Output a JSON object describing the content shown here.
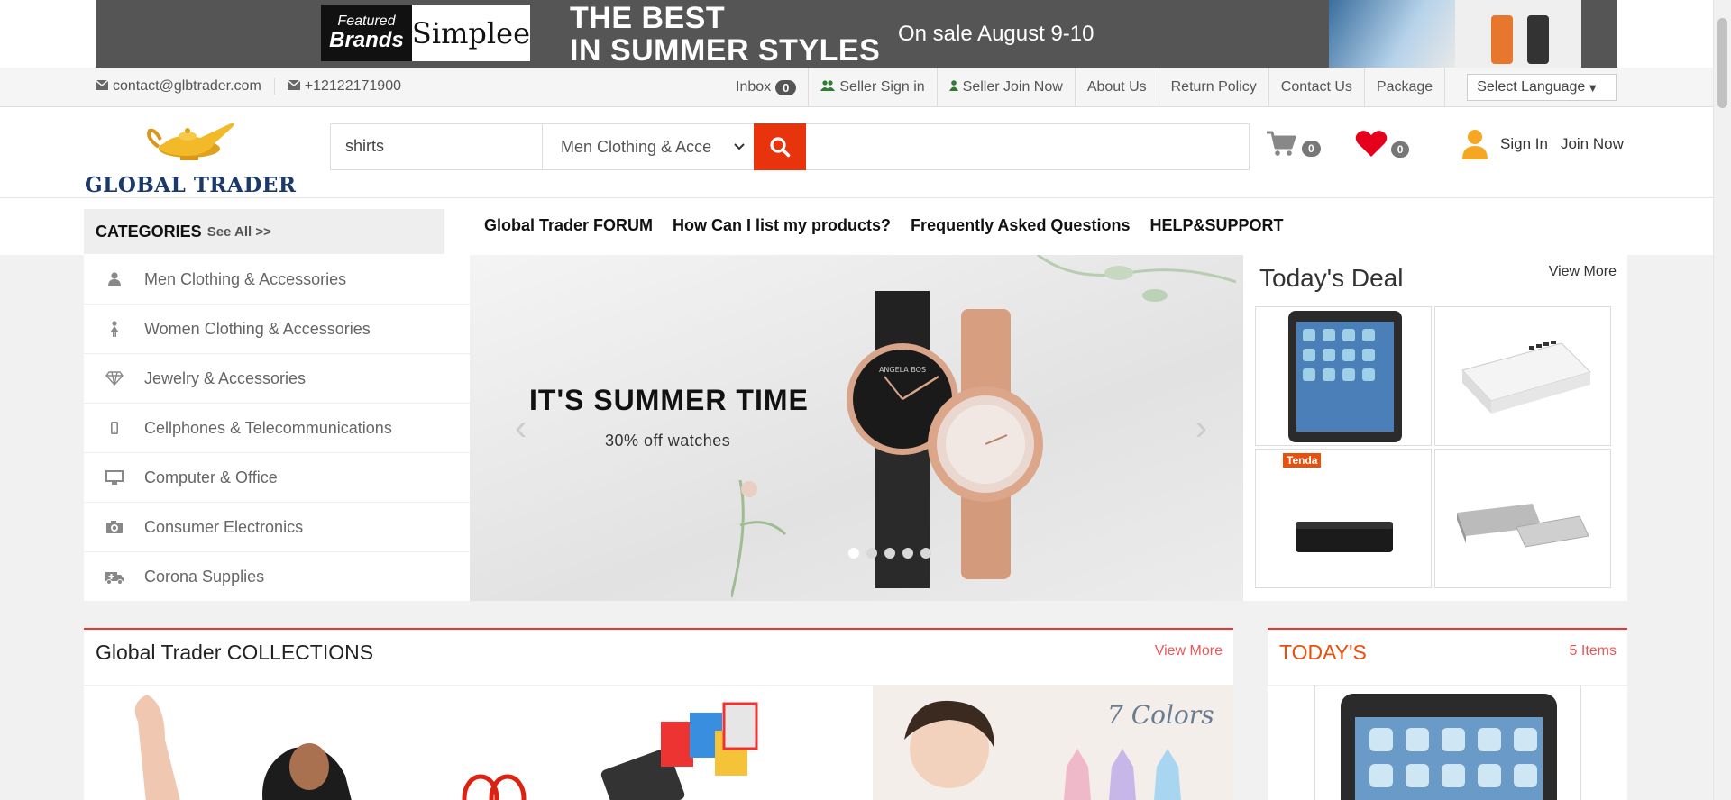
{
  "banner": {
    "brand_featured_line1": "Featured",
    "brand_featured_line2": "Brands",
    "brand_name": "Simplee",
    "headline_line1": "THE BEST",
    "headline_line2": "IN SUMMER STYLES",
    "sale_text": "On sale August 9-10"
  },
  "infobar": {
    "email": "contact@glbtrader.com",
    "phone": "+12122171900",
    "inbox_label": "Inbox",
    "inbox_count": "0",
    "seller_signin": "Seller Sign in",
    "seller_join": "Seller Join Now",
    "about": "About Us",
    "return_policy": "Return Policy",
    "contact": "Contact Us",
    "package": "Package",
    "language": "Select Language"
  },
  "header": {
    "logo_text": "GLOBAL TRADER",
    "search_value": "shirts",
    "category_value": "Men Clothing & Acce",
    "cart_count": "0",
    "wishlist_count": "0",
    "sign_in": "Sign In",
    "join_now": "Join Now"
  },
  "nav": {
    "categories_label": "CATEGORIES",
    "see_all": "See All >>",
    "links": [
      "Global Trader FORUM",
      "How Can I list my products?",
      "Frequently Asked Questions",
      "HELP&SUPPORT"
    ]
  },
  "categories": [
    {
      "label": "Men Clothing & Accessories",
      "icon": "user-icon"
    },
    {
      "label": "Women Clothing & Accessories",
      "icon": "female-icon"
    },
    {
      "label": "Jewelry & Accessories",
      "icon": "diamond-icon"
    },
    {
      "label": "Cellphones & Telecommunications",
      "icon": "mobile-icon"
    },
    {
      "label": "Computer & Office",
      "icon": "desktop-icon"
    },
    {
      "label": "Consumer Electronics",
      "icon": "camera-icon"
    },
    {
      "label": "Corona Supplies",
      "icon": "ambulance-icon"
    }
  ],
  "slider": {
    "headline": "IT'S SUMMER TIME",
    "subline": "30% off watches",
    "watch_brand": "ANGELA BOS"
  },
  "deal": {
    "title": "Today's Deal",
    "view_more": "View More",
    "tenda_label": "Tenda"
  },
  "collections": {
    "title": "Global Trader COLLECTIONS",
    "view_more": "View More",
    "colors_text": "7 Colors"
  },
  "todays": {
    "title": "TODAY'S",
    "count": "5 Items"
  },
  "colors": {
    "accent_red": "#e8340c",
    "section_border": "#e33",
    "logo_navy": "#1b3a6b",
    "user_orange": "#f5a623",
    "heart_red": "#e5001b"
  }
}
